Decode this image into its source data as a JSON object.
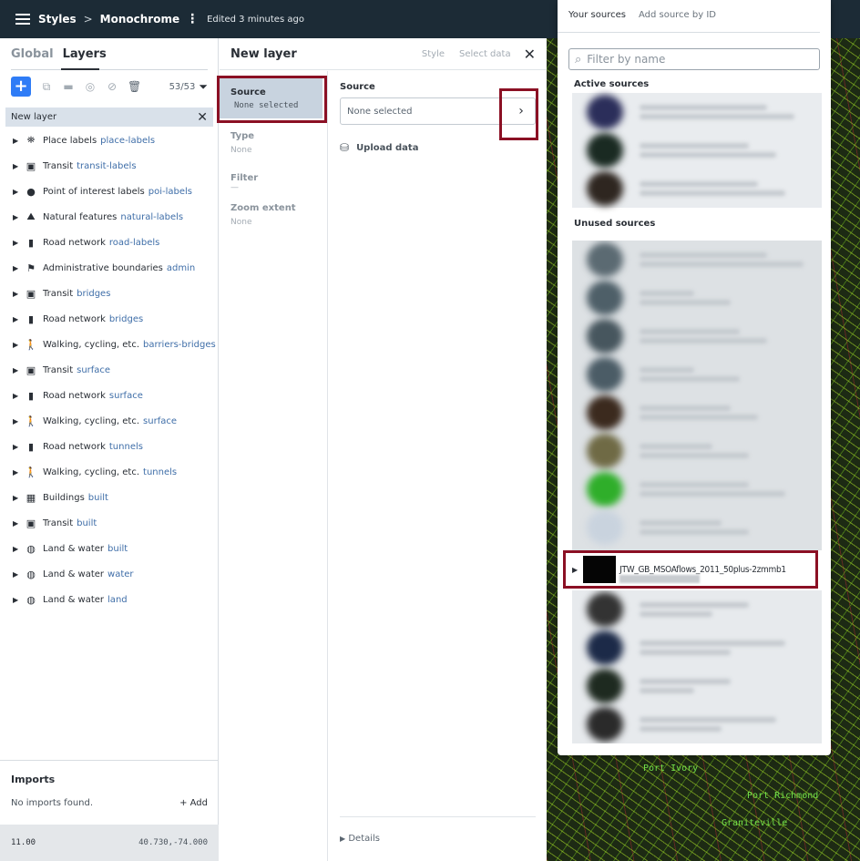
{
  "topbar": {
    "styles": "Styles",
    "separator": ">",
    "style_name": "Monochrome",
    "edited": "Edited 3 minutes ago"
  },
  "left_panel": {
    "tabs": [
      "Global",
      "Layers"
    ],
    "layer_count": "53/53",
    "new_layer": "New layer",
    "layers": [
      {
        "name": "Place labels",
        "id": "place-labels",
        "icon": "place-labels-icon"
      },
      {
        "name": "Transit",
        "id": "transit-labels",
        "icon": "transit-icon"
      },
      {
        "name": "Point of interest labels",
        "id": "poi-labels",
        "icon": "poi-pin-icon"
      },
      {
        "name": "Natural features",
        "id": "natural-labels",
        "icon": "natural-features-icon"
      },
      {
        "name": "Road network",
        "id": "road-labels",
        "icon": "road-network-icon"
      },
      {
        "name": "Administrative boundaries",
        "id": "admin",
        "icon": "admin-flag-icon"
      },
      {
        "name": "Transit",
        "id": "bridges",
        "icon": "transit-icon"
      },
      {
        "name": "Road network",
        "id": "bridges",
        "icon": "road-network-icon"
      },
      {
        "name": "Walking, cycling, etc.",
        "id": "barriers-bridges",
        "icon": "walking-icon"
      },
      {
        "name": "Transit",
        "id": "surface",
        "icon": "transit-icon"
      },
      {
        "name": "Road network",
        "id": "surface",
        "icon": "road-network-icon"
      },
      {
        "name": "Walking, cycling, etc.",
        "id": "surface",
        "icon": "walking-icon"
      },
      {
        "name": "Road network",
        "id": "tunnels",
        "icon": "road-network-icon"
      },
      {
        "name": "Walking, cycling, etc.",
        "id": "tunnels",
        "icon": "walking-icon"
      },
      {
        "name": "Buildings",
        "id": "built",
        "icon": "buildings-icon"
      },
      {
        "name": "Transit",
        "id": "built",
        "icon": "transit-icon"
      },
      {
        "name": "Land & water",
        "id": "built",
        "icon": "globe-icon"
      },
      {
        "name": "Land & water",
        "id": "water",
        "icon": "globe-icon"
      },
      {
        "name": "Land & water",
        "id": "land",
        "icon": "globe-icon"
      }
    ],
    "imports_title": "Imports",
    "imports_empty": "No imports found.",
    "imports_add": "Add",
    "zoom": "11.00",
    "coords": "40.730,-74.000"
  },
  "mid_panel": {
    "title": "New layer",
    "link_style": "Style",
    "link_select": "Select data",
    "steps": {
      "source_label": "Source",
      "source_value": "None selected",
      "type_label": "Type",
      "type_value": "None",
      "filter_label": "Filter",
      "filter_value": "—",
      "zoom_label": "Zoom extent",
      "zoom_value": "None"
    },
    "source_field_label": "Source",
    "source_select_value": "None selected",
    "upload": "Upload data",
    "details": "Details"
  },
  "map": {
    "labels": [
      "Port Ivory",
      "Port Richmond",
      "Graniteville"
    ]
  },
  "popup": {
    "tabs": [
      "Your sources",
      "Add source by ID"
    ],
    "filter_placeholder": "Filter by name",
    "active_heading": "Active sources",
    "unused_heading": "Unused sources",
    "highlighted_source": "JTW_GB_MSOAflows_2011_50plus-2zmmb1"
  },
  "colors": {
    "accent": "#2f7cf6",
    "topbar": "#1c2b36",
    "highlight_box": "#8b1024",
    "link": "#3f6ea8"
  }
}
